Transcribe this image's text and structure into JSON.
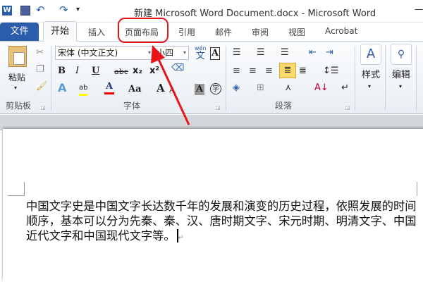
{
  "window": {
    "title": "新建 Microsoft Word Document.docx  -  Microsoft Word",
    "minimize": "—"
  },
  "quick_access": {
    "app_icon": "word-icon",
    "save": "save-icon",
    "undo": "undo-icon",
    "redo": "redo-icon",
    "customize": "customize-icon"
  },
  "tabs": [
    {
      "label": "文件"
    },
    {
      "label": "开始"
    },
    {
      "label": "插入"
    },
    {
      "label": "页面布局"
    },
    {
      "label": "引用"
    },
    {
      "label": "邮件"
    },
    {
      "label": "审阅"
    },
    {
      "label": "视图"
    },
    {
      "label": "Acrobat"
    }
  ],
  "clipboard": {
    "paste": "粘贴",
    "group": "剪贴板"
  },
  "font": {
    "name": "宋体 (中文正文)",
    "size": "小四",
    "group": "字体",
    "bold": "B",
    "italic": "I",
    "underline": "U",
    "strike": "abc",
    "sub": "x₂",
    "sup": "x²",
    "grow": "A",
    "shrink": "A",
    "aa": "Aa",
    "phonetic": "wén",
    "phonetic_char": "文",
    "border_char": "A",
    "shade_char": "A",
    "enclose_char": "字"
  },
  "paragraph": {
    "group": "段落"
  },
  "styles": {
    "label": "样式"
  },
  "editing": {
    "label": "编辑"
  },
  "document": {
    "text": "中国文字史是中国文字长达数千年的发展和演变的历史过程，依照发展的时间顺序，基本可以分为先秦、秦、汉、唐时期文字、宋元时期、明清文字、中国近代文字和中国现代文字等。",
    "para_mark": "↵"
  },
  "annotation": {
    "color": "#e8141a"
  }
}
